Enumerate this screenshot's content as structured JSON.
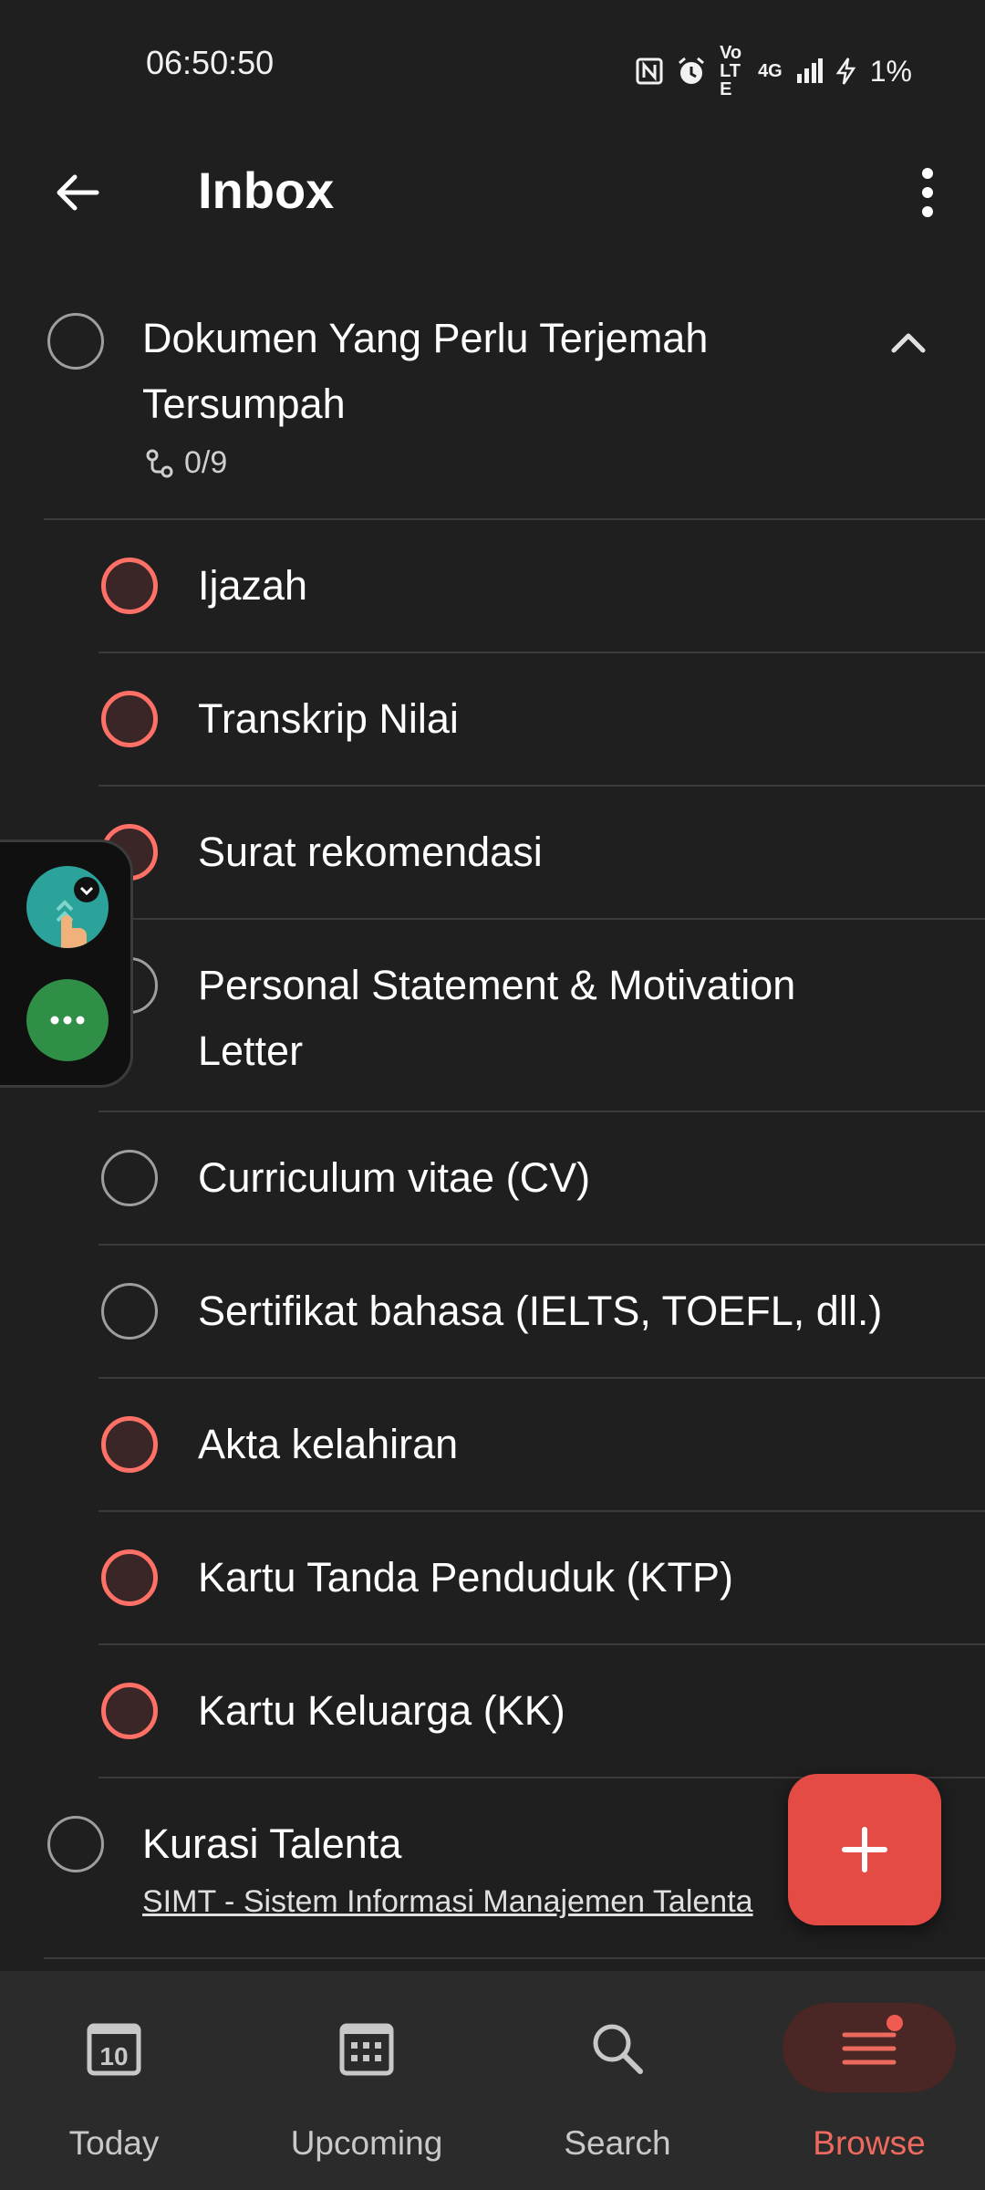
{
  "status_bar": {
    "time": "06:50:50",
    "volte": "Vo LTE",
    "network": "4G",
    "battery": "1%"
  },
  "app_bar": {
    "title": "Inbox"
  },
  "parent_task": {
    "title_line1": "Dokumen Yang Perlu Terjemah",
    "title_line2": "Tersumpah",
    "subtask_count": "0/9"
  },
  "subtasks": [
    {
      "label": "Ijazah",
      "priority": "p1"
    },
    {
      "label": "Transkrip Nilai",
      "priority": "p1"
    },
    {
      "label": "Surat rekomendasi",
      "priority": "p1"
    },
    {
      "label_line1": "Personal Statement & Motivation",
      "label_line2": "Letter",
      "priority": "none"
    },
    {
      "label": "Curriculum vitae (CV)",
      "priority": "none"
    },
    {
      "label": "Sertifikat bahasa (IELTS, TOEFL, dll.)",
      "priority": "none"
    },
    {
      "label": "Akta kelahiran",
      "priority": "p1"
    },
    {
      "label": "Kartu Tanda Penduduk (KTP)",
      "priority": "p1"
    },
    {
      "label": "Kartu Keluarga (KK)",
      "priority": "p1"
    }
  ],
  "next_task": {
    "title": "Kurasi Talenta",
    "description": "SIMT - Sistem Informasi Manajemen Talenta"
  },
  "calendar_day": "10",
  "bottom_nav": [
    {
      "label": "Today",
      "icon": "calendar-today-icon"
    },
    {
      "label": "Upcoming",
      "icon": "calendar-grid-icon"
    },
    {
      "label": "Search",
      "icon": "search-icon"
    },
    {
      "label": "Browse",
      "icon": "menu-lines-icon",
      "active": true
    }
  ],
  "colors": {
    "background": "#1f1f1f",
    "priority1": "#ff7066",
    "accent": "#e44b45",
    "nav_active": "#ee6a5f"
  }
}
